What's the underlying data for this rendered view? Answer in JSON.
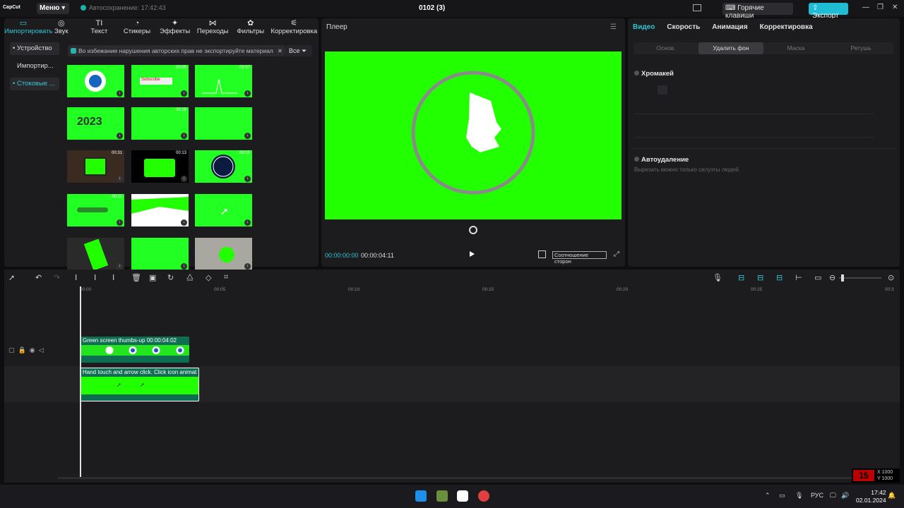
{
  "app": {
    "logo": "CapCut",
    "menu_label": "Меню",
    "autosave": "Автосохранение: 17:42:43",
    "project_title": "0102 (3)",
    "hotkeys_label": "Горячие клавиши",
    "export_label": "Экспорт",
    "accent_color": "#1fbcd3"
  },
  "media_toolbar": [
    {
      "label": "Импортировать",
      "icon": "import-icon"
    },
    {
      "label": "Звук",
      "icon": "music-icon"
    },
    {
      "label": "Текст",
      "icon": "text-icon"
    },
    {
      "label": "Стикеры",
      "icon": "sticker-icon"
    },
    {
      "label": "Эффекты",
      "icon": "effects-icon"
    },
    {
      "label": "Переходы",
      "icon": "transition-icon"
    },
    {
      "label": "Фильтры",
      "icon": "filter-icon"
    },
    {
      "label": "Корректировка",
      "icon": "adjust-icon"
    }
  ],
  "side_nav": [
    {
      "label": "• Устройство"
    },
    {
      "label": "Импортир..."
    },
    {
      "label": "• Стоковые ..."
    }
  ],
  "notice": "Во избежание нарушения авторских прав не экспортируйте материал",
  "filter_label": "Все",
  "thumbnails": [
    {
      "dur": "",
      "type": "like"
    },
    {
      "dur": "00:05",
      "type": "subscribe",
      "text": "Subscribe"
    },
    {
      "dur": "00:57",
      "type": "wave"
    },
    {
      "dur": "",
      "type": "year",
      "text": "2023"
    },
    {
      "dur": "00:26",
      "type": "plain"
    },
    {
      "dur": "",
      "type": "plain"
    },
    {
      "dur": "00:31",
      "type": "tv"
    },
    {
      "dur": "00:13",
      "type": "tv2"
    },
    {
      "dur": "00:15",
      "type": "clock"
    },
    {
      "dur": "00:11",
      "type": "bar"
    },
    {
      "dur": "",
      "type": "tear"
    },
    {
      "dur": "",
      "type": "cursor"
    },
    {
      "dur": "",
      "type": "phone"
    },
    {
      "dur": "",
      "type": "plain"
    },
    {
      "dur": "",
      "type": "hole"
    }
  ],
  "player": {
    "title": "Плеер",
    "time_current": "00:00:00:00",
    "time_total": "00:00:04:11",
    "aspect_label": "Соотношение сторон"
  },
  "properties": {
    "tabs": [
      "Видео",
      "Скорость",
      "Анимация",
      "Корректировка"
    ],
    "subtabs": [
      "Основ.",
      "Удалить фон",
      "Маска",
      "Ретушь"
    ],
    "chroma_label": "Хромакей",
    "auto_remove_label": "Автоудаление",
    "hint": "Вырезать можно только силуэты людей."
  },
  "timeline": {
    "ruler": [
      "00:00",
      "00:05",
      "00:10",
      "00:15",
      "00:20",
      "00:25",
      "00:3"
    ],
    "clip1_label": "Green screen thumbs-up  00:00:04:02",
    "clip2_label": "Hand touch and arrow click. Click icon animat"
  },
  "taskbar": {
    "lang": "РУС",
    "time": "17:42",
    "date": "02.01.2024"
  },
  "overlay": {
    "x": "X 1000",
    "y": "Y 1000"
  }
}
